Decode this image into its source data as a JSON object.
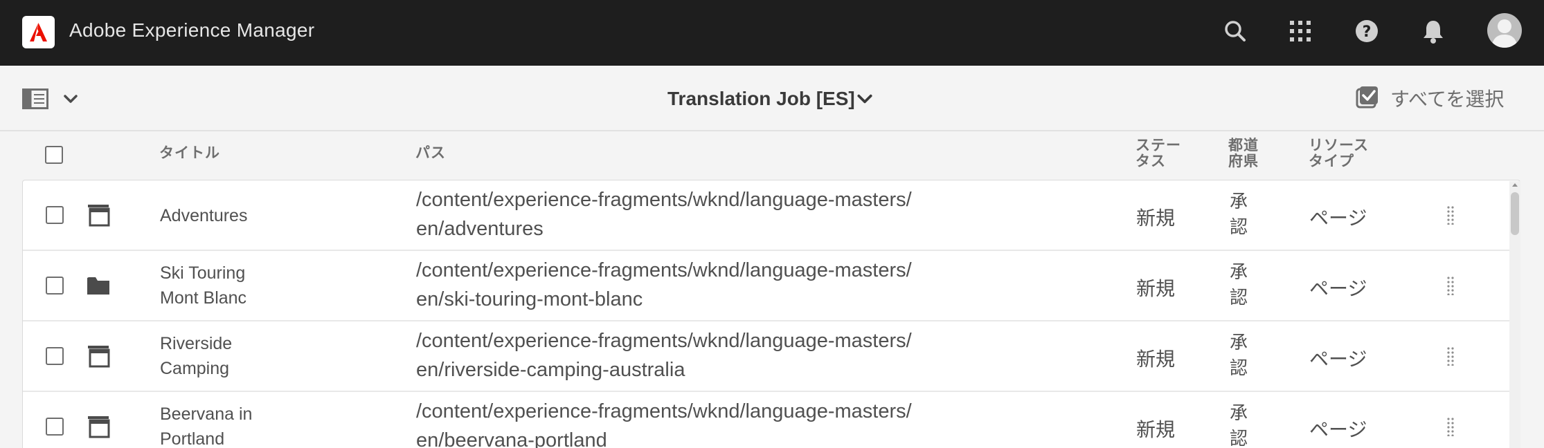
{
  "shell": {
    "app_title": "Adobe Experience Manager",
    "icons": [
      "search-icon",
      "apps-grid-icon",
      "help-icon",
      "notifications-bell-icon",
      "user-avatar"
    ]
  },
  "actionbar": {
    "job_title": "Translation Job [ES]",
    "select_all_label": "すべてを選択"
  },
  "table": {
    "columns": {
      "title": "タイトル",
      "path": "パス",
      "status": "ステータス",
      "state": "都道府県",
      "resource_type": "リソースタイプ"
    },
    "rows": [
      {
        "title": "Adventures",
        "icon": "page-icon",
        "path": "/content/experience-fragments/wknd/language-masters/en/adventures",
        "status": "新規",
        "state": "承認",
        "type": "ページ"
      },
      {
        "title": "Ski Touring Mont Blanc",
        "icon": "folder-icon",
        "path": "/content/experience-fragments/wknd/language-masters/en/ski-touring-mont-blanc",
        "status": "新規",
        "state": "承認",
        "type": "ページ"
      },
      {
        "title": "Riverside Camping",
        "icon": "page-icon",
        "path": "/content/experience-fragments/wknd/language-masters/en/riverside-camping-australia",
        "status": "新規",
        "state": "承認",
        "type": "ページ"
      },
      {
        "title": "Beervana in Portland",
        "icon": "page-icon",
        "path": "/content/experience-fragments/wknd/language-masters/en/beervana-portland",
        "status": "新規",
        "state": "承認",
        "type": "ページ"
      }
    ]
  },
  "colors": {
    "shell_bg": "#1e1e1e",
    "adobe_red": "#eb1000",
    "page_bg": "#f4f4f4"
  }
}
